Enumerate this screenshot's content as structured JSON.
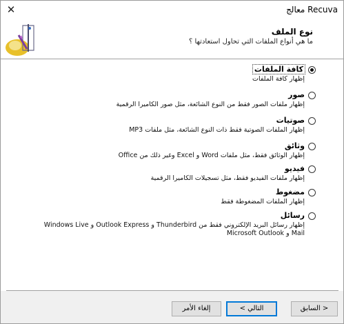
{
  "window": {
    "title": "Recuva معالج",
    "close_glyph": "✕"
  },
  "header": {
    "title": "نوع الملف",
    "subtitle": "ما هي أنواع الملفات التي تحاول استعادتها ؟"
  },
  "options": [
    {
      "title": "كافة الملفات",
      "description": "إظهار كافة الملفات",
      "checked": true
    },
    {
      "title": "صور",
      "description": "إظهار ملفات الصور فقط من النوع الشائعة، مثل صور الكاميرا الرقمية",
      "checked": false
    },
    {
      "title": "صوتيات",
      "description": "إظهار الملفات الصوتية فقط ذات النوع الشائعة، مثل ملفات MP3",
      "checked": false
    },
    {
      "title": "وثائق",
      "description": "إظهار الوثائق فقط، مثل ملفات Word و Excel وغير ذلك من Office",
      "checked": false
    },
    {
      "title": "فيديو",
      "description": "إظهار ملفات الفيديو فقط، مثل تسجيلات الكاميرا الرقمية",
      "checked": false
    },
    {
      "title": "مضغوط",
      "description": "إظهار الملفات المضغوطة فقط",
      "checked": false
    },
    {
      "title": "رسائل",
      "description": "إظهار رسائل البريد الإلكتروني فقط من Thunderbird و Outlook Express و Windows Live Mail و Microsoft Outlook",
      "checked": false
    }
  ],
  "buttons": {
    "back": "< السابق",
    "next": "التالي >",
    "cancel": "إلغاء الأمر"
  },
  "colors": {
    "accent": "#0078d7",
    "footer_bg": "#f0f0f0",
    "separator": "#a0a0a0"
  }
}
